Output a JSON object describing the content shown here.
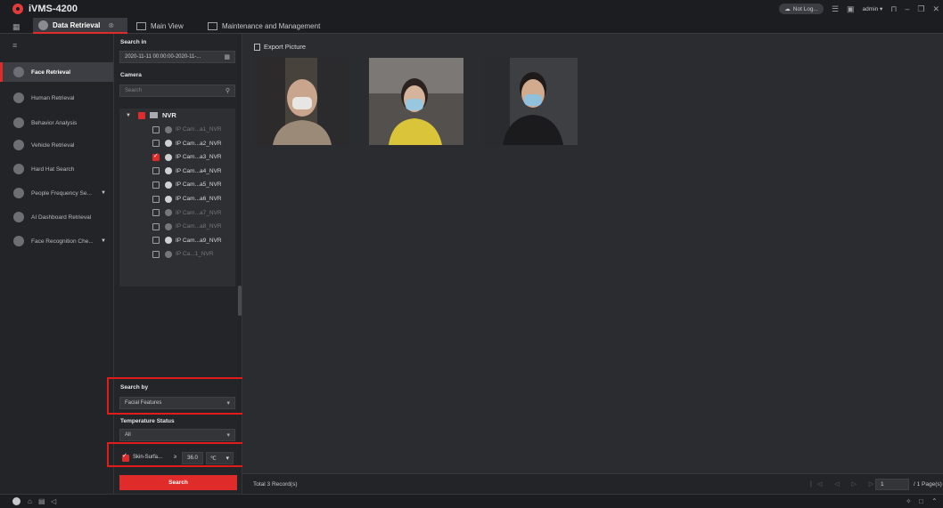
{
  "app": {
    "title": "iVMS-4200",
    "status_pill": "Not Log...",
    "user": "admin ▾",
    "window_controls": [
      "lock-icon",
      "minimize-icon",
      "restore-icon",
      "close-icon"
    ]
  },
  "tabs": [
    {
      "label": "Data Retrieval",
      "active": true
    },
    {
      "label": "Main View"
    },
    {
      "label": "Maintenance and Management"
    }
  ],
  "sidebar": {
    "items": [
      {
        "label": "Face Retrieval",
        "active": true
      },
      {
        "label": "Human Retrieval"
      },
      {
        "label": "Behavior Analysis"
      },
      {
        "label": "Vehicle Retrieval"
      },
      {
        "label": "Hard Hat Search"
      },
      {
        "label": "People Frequency Se...",
        "has_caret": true
      },
      {
        "label": "AI Dashboard Retrieval"
      },
      {
        "label": "Face Recognition Che...",
        "has_caret": true
      }
    ]
  },
  "panel": {
    "search_in_label": "Search in",
    "date_range": "2020-11-11 00:00:00-2020-11-...",
    "camera_label": "Camera",
    "camera_search_placeholder": "Search",
    "tree_root": "NVR",
    "cameras": [
      {
        "label": "IP Cam...a1_NVR",
        "checked": false,
        "online": false
      },
      {
        "label": "IP Cam...a2_NVR",
        "checked": false,
        "online": true
      },
      {
        "label": "IP Cam...a3_NVR",
        "checked": true,
        "online": true
      },
      {
        "label": "IP Cam...a4_NVR",
        "checked": false,
        "online": true
      },
      {
        "label": "IP Cam...a5_NVR",
        "checked": false,
        "online": true
      },
      {
        "label": "IP Cam...a6_NVR",
        "checked": false,
        "online": true
      },
      {
        "label": "IP Cam...a7_NVR",
        "checked": false,
        "online": false
      },
      {
        "label": "IP Cam...a8_NVR",
        "checked": false,
        "online": false
      },
      {
        "label": "IP Cam...a9_NVR",
        "checked": false,
        "online": true
      },
      {
        "label": "IP Ca...1_NVR",
        "checked": false,
        "online": false
      }
    ],
    "search_by_label": "Search by",
    "search_by_value": "Facial Features",
    "temperature_status_label": "Temperature Status",
    "temperature_status_value": "All",
    "skin_label": "Skin-Surfa...",
    "skin_operator": "≥",
    "skin_value": "36.0",
    "skin_unit": "℃",
    "search_button": "Search"
  },
  "content": {
    "export_label": "Export Picture",
    "total_records": "Total 3 Record(s)",
    "page_input": "1",
    "page_total": "/ 1 Page(s)"
  },
  "colors": {
    "accent": "#e02b2b",
    "highlight_box": "#e21b1b",
    "background": "#2b2d31"
  }
}
